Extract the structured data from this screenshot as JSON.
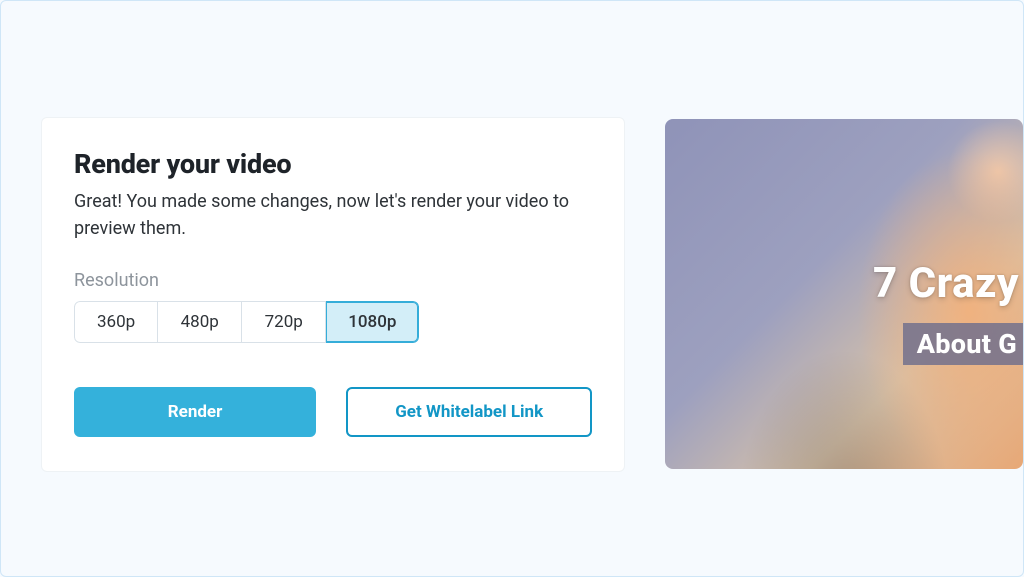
{
  "panel": {
    "title": "Render your video",
    "subtitle": "Great! You made some changes, now let's render your video to preview them.",
    "resolution_label": "Resolution",
    "resolution_options": [
      {
        "label": "360p",
        "selected": false
      },
      {
        "label": "480p",
        "selected": false
      },
      {
        "label": "720p",
        "selected": false
      },
      {
        "label": "1080p",
        "selected": true
      }
    ],
    "render_button": "Render",
    "whitelabel_button": "Get Whitelabel Link"
  },
  "preview": {
    "title_visible": "7 Crazy",
    "subtitle_visible": "About G"
  },
  "colors": {
    "accent": "#34b1db",
    "accent_dark": "#1296c6"
  }
}
